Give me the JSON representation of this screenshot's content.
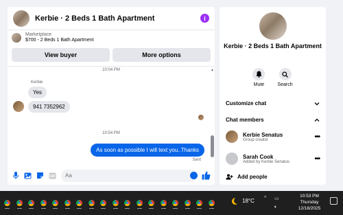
{
  "chat": {
    "title": "Kerbie · 2 Beds 1 Bath Apartment",
    "listing": {
      "category": "Marketplace",
      "summary": "$700 - 2 Beds 1 Bath Apartment"
    },
    "buttons": {
      "view_buyer": "View buyer",
      "more_options": "More options"
    },
    "messages": {
      "timestamp1": "10:04 PM",
      "sender": "Kerbie",
      "msg1": "Yes",
      "msg2": "941 7352962",
      "timestamp2": "10:54 PM",
      "outgoing": "As soon as possible I will text you..Thanks",
      "status": "Sent"
    },
    "composer": {
      "placeholder": "Aa"
    }
  },
  "details": {
    "title": "Kerbie · 2 Beds 1 Bath Apartment",
    "actions": {
      "mute": "Mute",
      "search": "Search"
    },
    "customize": "Customize chat",
    "members_heading": "Chat members",
    "members": [
      {
        "name": "Kerbie Senatus",
        "sub": "Group creator"
      },
      {
        "name": "Sarah Cook",
        "sub": "Added by Kerbie Senatus"
      }
    ],
    "add_people": "Add people"
  },
  "taskbar": {
    "weather": "18°C",
    "time": "10:53 PM",
    "day": "Thursday",
    "date": "12/18/2025"
  },
  "colors": {
    "accent": "#0a66e8",
    "info": "#9b2ff7"
  }
}
